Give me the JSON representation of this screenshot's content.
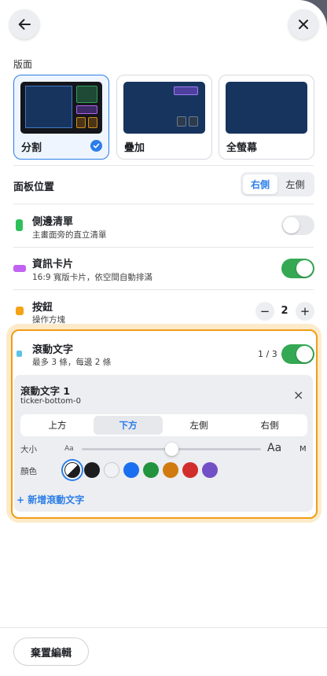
{
  "layout_section": {
    "label": "版面",
    "options": [
      {
        "name": "分割",
        "selected": true
      },
      {
        "name": "疊加",
        "selected": false
      },
      {
        "name": "全螢幕",
        "selected": false
      }
    ]
  },
  "panel_position": {
    "label": "面板位置",
    "options": [
      "右側",
      "左側"
    ],
    "selected": "右側"
  },
  "items": [
    {
      "title": "側邊清單",
      "subtitle": "主畫面旁的直立清單",
      "color": "#2ec05a",
      "enabled": false
    },
    {
      "title": "資訊卡片",
      "subtitle": "16:9 寬版卡片，依空間自動排滿",
      "color": "#c063f2",
      "enabled": true
    },
    {
      "title": "按鈕",
      "subtitle": "操作方塊",
      "color": "#f5a214",
      "count": "2",
      "minus": "−",
      "plus": "+"
    },
    {
      "title": "滾動文字",
      "subtitle": "最多 3 條，每邊 2 條",
      "color": "#5bc3e8",
      "enabled": true,
      "fraction": "1 / 3"
    }
  ],
  "ticker": {
    "title": "滾動文字 1",
    "id": "ticker-bottom-0",
    "close_symbol": "×",
    "positions": [
      "上方",
      "下方",
      "左側",
      "右側"
    ],
    "selected_position": "下方",
    "size_label": "大小",
    "size_small": "Aa",
    "size_large": "Aa",
    "size_value": "M",
    "size_level": 0.5,
    "color_label": "顏色",
    "colors": [
      "auto",
      "#1d1d1f",
      "#f1f2f4",
      "#1a6ff0",
      "#22933f",
      "#d07a10",
      "#d12d2d",
      "#7250c6"
    ],
    "selected_color": "auto"
  },
  "add_ticker_label": "+ 新增滾動文字",
  "reset_label": "棄置編輯"
}
